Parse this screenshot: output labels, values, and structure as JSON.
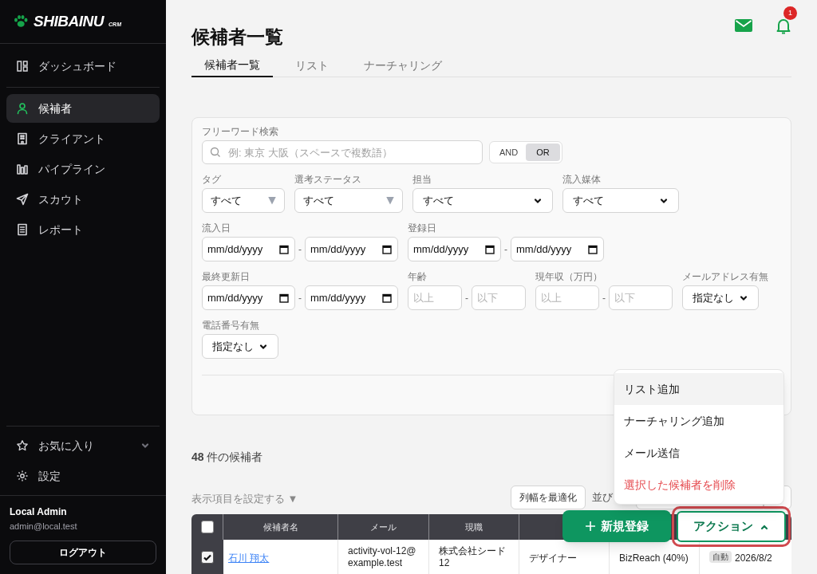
{
  "sidebar": {
    "logo": {
      "name": "SHIBAINU",
      "suffix": "CRM"
    },
    "top_items": [
      {
        "label": "ダッシュボード",
        "selected": false
      }
    ],
    "items": [
      {
        "label": "候補者",
        "selected": true
      },
      {
        "label": "クライアント",
        "selected": false
      },
      {
        "label": "パイプライン",
        "selected": false
      },
      {
        "label": "スカウト",
        "selected": false
      },
      {
        "label": "レポート",
        "selected": false
      }
    ],
    "bottom_items": [
      {
        "label": "お気に入り",
        "kind": "group"
      },
      {
        "label": "設定",
        "kind": "link"
      }
    ],
    "user": {
      "name": "Local Admin",
      "email": "admin@local.test"
    },
    "logout": "ログアウト"
  },
  "header": {
    "title": "候補者一覧",
    "notification_count": "1",
    "tabs": [
      {
        "label": "候補者一覧",
        "selected": true
      },
      {
        "label": "リスト",
        "selected": false
      },
      {
        "label": "ナーチャリング",
        "selected": false
      }
    ]
  },
  "filters": {
    "keyword": {
      "label": "フリーワード検索",
      "placeholder": "例: 東京 大阪（スペースで複数語）"
    },
    "match_mode": [
      {
        "label": "AND",
        "selected": false
      },
      {
        "label": "OR",
        "selected": true
      }
    ],
    "fields": [
      {
        "kind": "combo",
        "label": "タグ",
        "value": "すべて"
      },
      {
        "kind": "combo",
        "label": "選考ステータス",
        "value": "すべて"
      },
      {
        "kind": "select",
        "label": "担当",
        "value": "すべて"
      },
      {
        "kind": "select",
        "label": "流入媒体",
        "value": "すべて"
      },
      {
        "kind": "date-range",
        "label": "流入日",
        "from": "mm/dd/yyyy",
        "separator": "-",
        "to": "mm/dd/yyyy"
      },
      {
        "kind": "date-range",
        "label": "登録日",
        "from": "mm/dd/yyyy",
        "separator": "-",
        "to": "mm/dd/yyyy"
      },
      {
        "kind": "date-range",
        "label": "最終更新日",
        "from": "mm/dd/yyyy",
        "separator": "-",
        "to": "mm/dd/yyyy"
      },
      {
        "kind": "number-range",
        "label": "年齢",
        "from_placeholder": "以上",
        "separator": "-",
        "to_placeholder": "以下"
      },
      {
        "kind": "number-range",
        "label": "現年収（万円）",
        "from_placeholder": "以上",
        "separator": "-",
        "to_placeholder": "以下"
      },
      {
        "kind": "select",
        "label": "メールアドレス有無",
        "value": "指定なし"
      },
      {
        "kind": "select",
        "label": "電話番号有無",
        "value": "指定なし"
      }
    ]
  },
  "results": {
    "count": "**48** 件の候補者",
    "columns_toggle": "表示項目を設定する ▼",
    "fit_columns": "列幅を最適化",
    "sort_label": "並び"
  },
  "table": {
    "header_checked": false,
    "columns": [
      "候補者名",
      "メール",
      "現職"
    ],
    "rows": [
      {
        "checked": true,
        "name": "石川 翔太",
        "email": "activity-vol-12@example.test",
        "company": "株式会社シード 12",
        "position": "デザイナー",
        "source": "BizReach (40%)",
        "badge": "自動",
        "date": "2026/8/2"
      }
    ]
  },
  "actions": {
    "new": "新規登録",
    "menu_button": "アクション",
    "menu_open": true,
    "menu": [
      {
        "label": "リスト追加",
        "kind": "normal",
        "selected": true
      },
      {
        "label": "ナーチャリング追加",
        "kind": "normal",
        "selected": false
      },
      {
        "label": "メール送信",
        "kind": "normal",
        "selected": false
      },
      {
        "label": "選択した候補者を削除",
        "kind": "danger",
        "selected": false
      }
    ]
  }
}
